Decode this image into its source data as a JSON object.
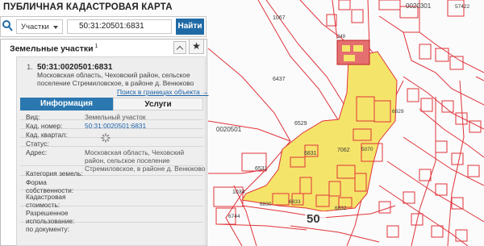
{
  "app": {
    "title": "ПУБЛИЧНАЯ КАДАСТРОВАЯ КАРТА"
  },
  "search": {
    "type_label": "Участки",
    "query": "50:31:20501:6831",
    "button_label": "Найти"
  },
  "panel": {
    "heading": "Земельные участки",
    "count": "1"
  },
  "result": {
    "index": "1.",
    "number": "50:31:0020501:6831",
    "address": "Московская область, Чеховский район, сельское поселение Стремиловское, в районе д. Венюково",
    "link": "Поиск в границах объекта →"
  },
  "tabs": {
    "info": "Информация",
    "services": "Услуги"
  },
  "attributes": {
    "vid_label": "Вид:",
    "vid_value": "Земельный участок",
    "kad_label": "Кад. номер:",
    "kad_value": "50:31:0020501:6831",
    "kvartal_label": "Кад. квартал:",
    "status_label": "Статус:",
    "address_label": "Адрес:",
    "address_value": "Московская область, Чеховский район, сельское поселение Стремиловское, в районе д. Венюково",
    "category_label": "Категория земель:",
    "ownership_label": "Форма собственности:",
    "cost_label": "Кадастровая стоимость:",
    "use_label": "Разрешенное использование:",
    "doc_label": "по документу:"
  },
  "map_labels": {
    "l1067": "1067",
    "l0020301": "0020301",
    "l57422": "57422",
    "l6437": "6437",
    "l6529": "6529",
    "l0020501": "0020501",
    "l6831": "6831",
    "l7062": "7062",
    "l6531": "6531",
    "l5070": "5070",
    "l6829": "6829",
    "l1034": "1034",
    "l6744": "6744",
    "l6832": "6832",
    "l6833": "6833",
    "l6830": "6830",
    "l50": "50",
    "l249": "249"
  },
  "colors": {
    "parcel_line": "#e0333a",
    "selected_fill": "#f5e46a",
    "accent": "#2b77b0"
  }
}
